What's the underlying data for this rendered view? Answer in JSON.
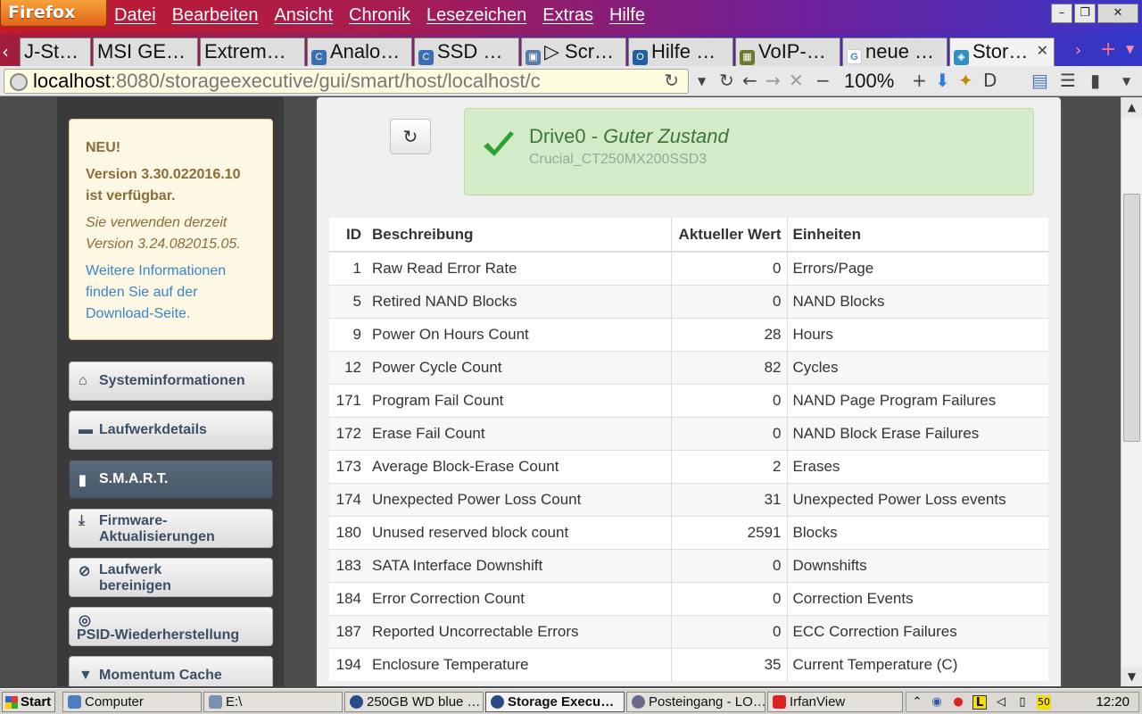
{
  "browser": {
    "app_button": "Firefox",
    "menu": [
      "Datei",
      "Bearbeiten",
      "Ansicht",
      "Chronik",
      "Lesezeichen",
      "Extras",
      "Hilfe"
    ],
    "tabs": [
      {
        "label": "J-St…"
      },
      {
        "label": "MSI GE…"
      },
      {
        "label": "Extrem…"
      },
      {
        "label": "Analo…"
      },
      {
        "label": "SSD …"
      },
      {
        "label": "▷ Scr…"
      },
      {
        "label": "Hilfe …"
      },
      {
        "label": "VoIP-…"
      },
      {
        "label": "neue …"
      },
      {
        "label": "Stor…"
      }
    ],
    "url_host": "localhost",
    "url_rest": ":8080/storageexecutive/gui/smart/host/localhost/c",
    "zoom": "100%"
  },
  "sidebar": {
    "notice": {
      "new": "NEU!",
      "version_line1": "Version 3.30.022016.10",
      "version_line2": "ist verfügbar.",
      "current_line1": "Sie verwenden derzeit",
      "current_line2": "Version 3.24.082015.05.",
      "link_line1": "Weitere Informationen",
      "link_line2": "finden Sie auf der",
      "link_line3": "Download-Seite."
    },
    "nav": [
      {
        "line1": "Systeminformationen",
        "line2": ""
      },
      {
        "line1": "Laufwerkdetails",
        "line2": ""
      },
      {
        "line1": "S.M.A.R.T.",
        "line2": ""
      },
      {
        "line1": "Firmware-",
        "line2": "Aktualisierungen"
      },
      {
        "line1": "Laufwerk",
        "line2": "bereinigen"
      },
      {
        "line1": "PSID-Wiederherstellung",
        "line2": ""
      },
      {
        "line1": "Momentum Cache",
        "line2": ""
      }
    ]
  },
  "status": {
    "drive": "Drive0",
    "separator": " - ",
    "state": "Guter Zustand",
    "model": "Crucial_CT250MX200SSD3"
  },
  "table": {
    "headers": [
      "ID",
      "Beschreibung",
      "Aktueller Wert",
      "Einheiten"
    ],
    "rows": [
      [
        "1",
        "Raw Read Error Rate",
        "0",
        "Errors/Page"
      ],
      [
        "5",
        "Retired NAND Blocks",
        "0",
        "NAND Blocks"
      ],
      [
        "9",
        "Power On Hours Count",
        "28",
        "Hours"
      ],
      [
        "12",
        "Power Cycle Count",
        "82",
        "Cycles"
      ],
      [
        "171",
        "Program Fail Count",
        "0",
        "NAND Page Program Failures"
      ],
      [
        "172",
        "Erase Fail Count",
        "0",
        "NAND Block Erase Failures"
      ],
      [
        "173",
        "Average Block-Erase Count",
        "2",
        "Erases"
      ],
      [
        "174",
        "Unexpected Power Loss Count",
        "31",
        "Unexpected Power Loss events"
      ],
      [
        "180",
        "Unused reserved block count",
        "2591",
        "Blocks"
      ],
      [
        "183",
        "SATA Interface Downshift",
        "0",
        "Downshifts"
      ],
      [
        "184",
        "Error Correction Count",
        "0",
        "Correction Events"
      ],
      [
        "187",
        "Reported Uncorrectable Errors",
        "0",
        "ECC Correction Failures"
      ],
      [
        "194",
        "Enclosure Temperature",
        "35",
        "Current Temperature (C)"
      ]
    ]
  },
  "taskbar": {
    "start": "Start",
    "items": [
      "Computer",
      "E:\\",
      "250GB WD blue …",
      "Storage Execu…",
      "Posteingang - LO…",
      "IrfanView"
    ],
    "tray_badge": "50",
    "clock": "12:20"
  },
  "colors": {
    "success_bg": "#d3ebc9",
    "success_text": "#3c763d",
    "notice_bg": "#fcf8e3",
    "nav_active": "#485767"
  }
}
